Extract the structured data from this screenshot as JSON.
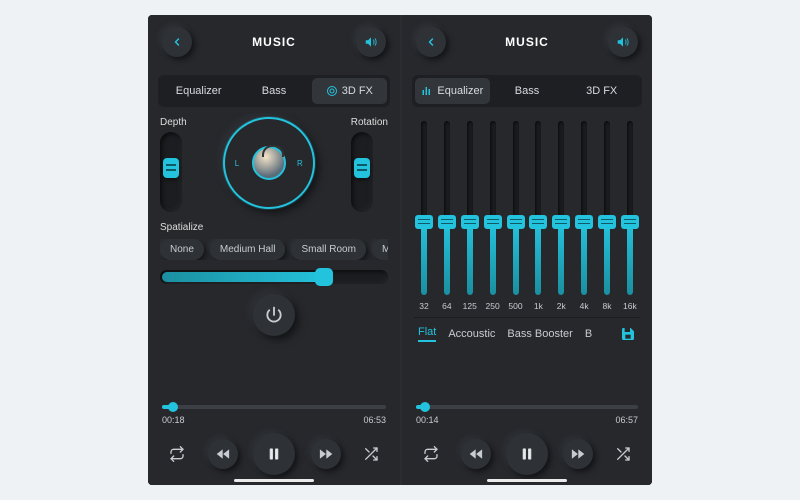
{
  "colors": {
    "accent": "#24c3dd",
    "bg": "#26282c",
    "panel": "#2e3136"
  },
  "left": {
    "title": "MUSIC",
    "tabs": {
      "equalizer": "Equalizer",
      "bass": "Bass",
      "fx": "3D FX",
      "active": "fx"
    },
    "fx": {
      "depth_label": "Depth",
      "rotation_label": "Rotation",
      "depth_pct": 55,
      "rotation_pct": 55,
      "dial_L": "L",
      "dial_R": "R",
      "spatialize_label": "Spatialize",
      "spat_options": [
        "None",
        "Medium Hall",
        "Small Room",
        "Med"
      ],
      "spat_slider_pct": 72
    },
    "player": {
      "elapsed": "00:18",
      "total": "06:53",
      "progress_pct": 5
    }
  },
  "right": {
    "title": "MUSIC",
    "tabs": {
      "equalizer": "Equalizer",
      "bass": "Bass",
      "fx": "3D FX",
      "active": "equalizer"
    },
    "eq": {
      "bands": [
        {
          "hz": "32",
          "pct": 42
        },
        {
          "hz": "64",
          "pct": 42
        },
        {
          "hz": "125",
          "pct": 42
        },
        {
          "hz": "250",
          "pct": 42
        },
        {
          "hz": "500",
          "pct": 42
        },
        {
          "hz": "1k",
          "pct": 42
        },
        {
          "hz": "2k",
          "pct": 42
        },
        {
          "hz": "4k",
          "pct": 42
        },
        {
          "hz": "8k",
          "pct": 42
        },
        {
          "hz": "16k",
          "pct": 42
        }
      ],
      "presets": [
        "Flat",
        "Accoustic",
        "Bass Booster",
        "B"
      ],
      "active_preset": "Flat"
    },
    "player": {
      "elapsed": "00:14",
      "total": "06:57",
      "progress_pct": 4
    }
  }
}
